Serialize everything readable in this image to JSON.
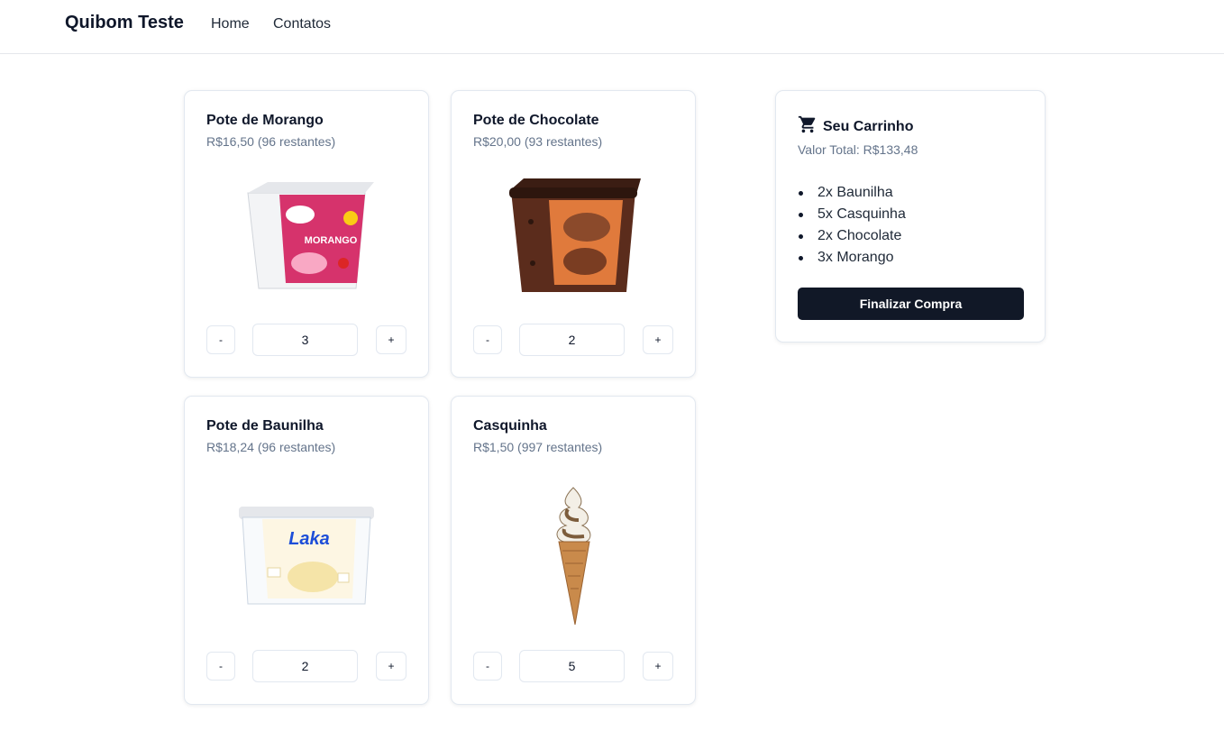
{
  "nav": {
    "brand": "Quibom Teste",
    "links": [
      "Home",
      "Contatos"
    ]
  },
  "products": [
    {
      "name": "Pote de Morango",
      "price_info": "R$16,50 (96 restantes)",
      "quantity": "3",
      "image": "strawberry-ice-cream-tub"
    },
    {
      "name": "Pote de Chocolate",
      "price_info": "R$20,00 (93 restantes)",
      "quantity": "2",
      "image": "chocolate-ice-cream-tub"
    },
    {
      "name": "Pote de Baunilha",
      "price_info": "R$18,24 (96 restantes)",
      "quantity": "2",
      "image": "vanilla-ice-cream-tub"
    },
    {
      "name": "Casquinha",
      "price_info": "R$1,50 (997 restantes)",
      "quantity": "5",
      "image": "soft-serve-cone"
    }
  ],
  "controls": {
    "minus": "-",
    "plus": "+"
  },
  "cart": {
    "title": "Seu Carrinho",
    "icon": "shopping-cart-icon",
    "total": "Valor Total: R$133,48",
    "items": [
      "2x Baunilha",
      "5x Casquinha",
      "2x Chocolate",
      "3x Morango"
    ],
    "checkout_label": "Finalizar Compra"
  },
  "colors": {
    "primary": "#111827",
    "muted_text": "#64748b",
    "border": "#e2e8f0"
  }
}
